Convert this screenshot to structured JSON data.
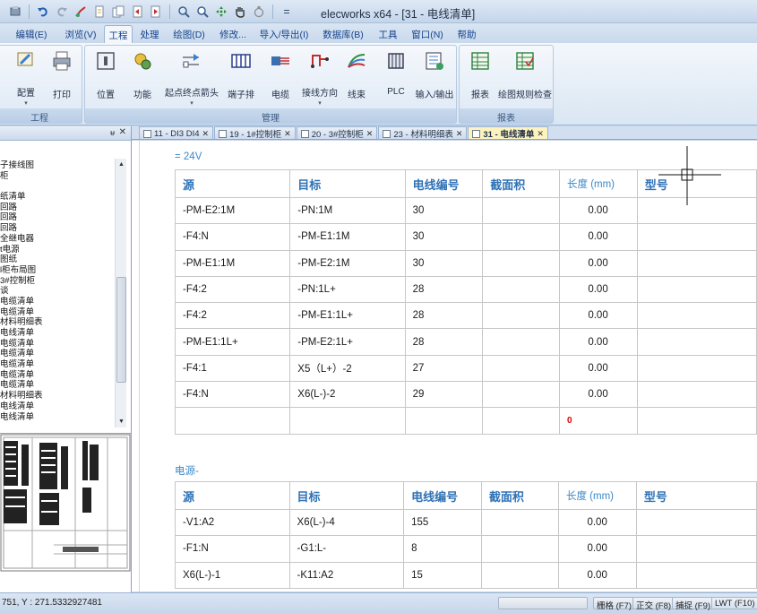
{
  "window": {
    "title": "elecworks x64 - [31 - 电线清单]",
    "menu_glyph": "="
  },
  "menu": {
    "items": [
      {
        "label": "编辑(E)"
      },
      {
        "label": "浏览(V)"
      },
      {
        "label": "工程",
        "active": true
      },
      {
        "label": "处理"
      },
      {
        "label": "绘图(D)"
      },
      {
        "label": "修改..."
      },
      {
        "label": "导入/导出(I)"
      },
      {
        "label": "数据库(B)"
      },
      {
        "label": "工具"
      },
      {
        "label": "窗口(N)"
      },
      {
        "label": "帮助"
      }
    ]
  },
  "ribbon": {
    "groups": [
      {
        "label": "工程",
        "buttons": [
          {
            "label": "配置",
            "icon": "config-icon",
            "dropdown": true
          },
          {
            "label": "打印",
            "icon": "printer-icon"
          }
        ]
      },
      {
        "label": "管理",
        "buttons": [
          {
            "label": "位置",
            "icon": "location-icon"
          },
          {
            "label": "功能",
            "icon": "function-icon"
          },
          {
            "label": "起点终点箭头",
            "icon": "origin-destination-arrow-icon",
            "dropdown": true
          },
          {
            "label": "端子排",
            "icon": "terminal-strip-icon"
          },
          {
            "label": "电缆",
            "icon": "cable-icon"
          },
          {
            "label": "接线方向",
            "icon": "wiring-direction-icon",
            "dropdown": true
          },
          {
            "label": "线束",
            "icon": "harness-icon"
          },
          {
            "label": "PLC",
            "icon": "plc-icon"
          },
          {
            "label": "输入/输出",
            "icon": "input-output-icon"
          }
        ]
      },
      {
        "label": "报表",
        "buttons": [
          {
            "label": "报表",
            "icon": "report-icon"
          },
          {
            "label": "绘图规则检查",
            "icon": "drawing-rules-check-icon"
          }
        ]
      }
    ]
  },
  "tree": {
    "items": [
      "子接线图",
      "柜",
      "",
      "纸清单",
      "回路",
      "回路",
      "回路",
      "全继电器",
      "t电源",
      "图纸",
      "l柜布局图",
      "3#控制柜",
      "谈",
      "电缆清单",
      "电缆清单",
      "材料明细表",
      "电线清单",
      "电缆清单",
      "电缆清单",
      "电缆清单",
      "电缆清单",
      "电缆清单",
      "材料明细表",
      "电线清单",
      "电线清单"
    ]
  },
  "doc_tabs": [
    {
      "label": "11 - DI3 DI4"
    },
    {
      "label": "19 - 1#控制柜"
    },
    {
      "label": "20 - 3#控制柜"
    },
    {
      "label": "23 - 材料明细表"
    },
    {
      "label": "31 - 电线清单",
      "active": true
    }
  ],
  "wire_list": {
    "columns": [
      "源",
      "目标",
      "电线编号",
      "截面积",
      "长度 (mm)",
      "型号"
    ],
    "sections": [
      {
        "label": "= 24V",
        "rows": [
          [
            "-PM-E2:1M",
            "-PN:1M",
            "30",
            "",
            "0.00",
            ""
          ],
          [
            "-F4:N",
            "-PM-E1:1M",
            "30",
            "",
            "0.00",
            ""
          ],
          [
            "-PM-E1:1M",
            "-PM-E2:1M",
            "30",
            "",
            "0.00",
            ""
          ],
          [
            "-F4:2",
            "-PN:1L+",
            "28",
            "",
            "0.00",
            ""
          ],
          [
            "-F4:2",
            "-PM-E1:1L+",
            "28",
            "",
            "0.00",
            ""
          ],
          [
            "-PM-E1:1L+",
            "-PM-E2:1L+",
            "28",
            "",
            "0.00",
            ""
          ],
          [
            "-F4:1",
            "X5（L+）-2",
            "27",
            "",
            "0.00",
            ""
          ],
          [
            "-F4:N",
            "X6(L-)-2",
            "29",
            "",
            "0.00",
            ""
          ]
        ],
        "total": "0"
      },
      {
        "label": "电源-",
        "rows": [
          [
            "-V1:A2",
            "X6(L-)-4",
            "155",
            "",
            "0.00",
            ""
          ],
          [
            "-F1:N",
            "-G1:L-",
            "8",
            "",
            "0.00",
            ""
          ],
          [
            "X6(L-)-1",
            "-K11:A2",
            "15",
            "",
            "0.00",
            ""
          ]
        ]
      }
    ]
  },
  "status": {
    "coords": "751, Y : 271.5332927481",
    "toggles": [
      "栅格 (F7)",
      "正交 (F8)",
      "捕捉 (F9)",
      "LWT (F10)"
    ]
  },
  "colors": {
    "header_text": "#2f72b6",
    "section_label": "#3a88c8",
    "total_red": "#e00000",
    "ribbon_text": "#15428b"
  }
}
